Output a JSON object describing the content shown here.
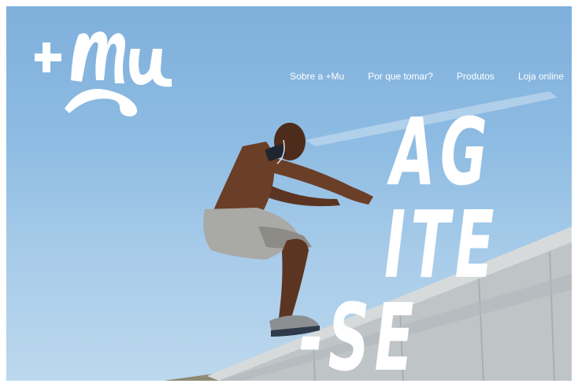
{
  "logo": {
    "text": "+Mu",
    "icon": "brand-logo"
  },
  "nav": {
    "items": [
      {
        "label": "Sobre a +Mu"
      },
      {
        "label": "Por que tomar?"
      },
      {
        "label": "Produtos"
      },
      {
        "label": "Loja online"
      }
    ]
  },
  "hero": {
    "headline_line1": "AG",
    "headline_line2": "ITE",
    "headline_line3": "-SE",
    "image": "athlete-jumping-photo"
  },
  "colors": {
    "sky": "#8dbbe2",
    "wall": "#c9ced1",
    "text": "#ffffff"
  }
}
